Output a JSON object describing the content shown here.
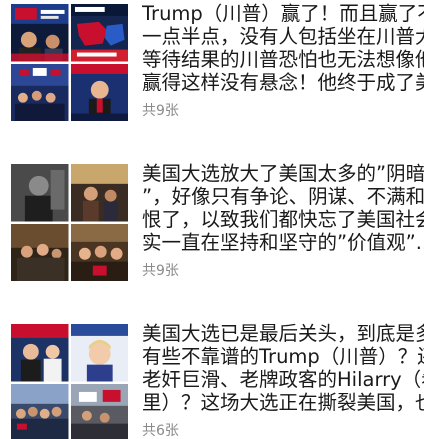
{
  "articles": [
    {
      "title_lines": [
        "Trump（川普）赢了！而且赢了不只",
        "一点半点，没有人包括坐在川普大厦",
        "等待结果的川普恐怕也无法想像他能",
        "赢得这样没有悬念！他终于成了美..."
      ],
      "meta": "共9张",
      "thumb_icon": "news-photo-grid-icon"
    },
    {
      "title_lines": [
        "美国大选放大了美国太多的”阴暗面",
        "”，好像只有争论、阴谋、不满和仇",
        "恨了，以致我们都快忘了美国社会其",
        "实一直在坚持和坚守的”价值观”..."
      ],
      "meta": "共9张",
      "thumb_icon": "photo-grid-icon"
    },
    {
      "title_lines": [
        "美国大选已是最后关头，到底是多少",
        "有些不靠谱的Trump（川普）？还是",
        "老奸巨滑、老牌政客的Hilarry（希拉",
        "里）？这场大选正在撕裂美国，也..."
      ],
      "meta": "共6张",
      "thumb_icon": "politics-photo-grid-icon"
    }
  ]
}
